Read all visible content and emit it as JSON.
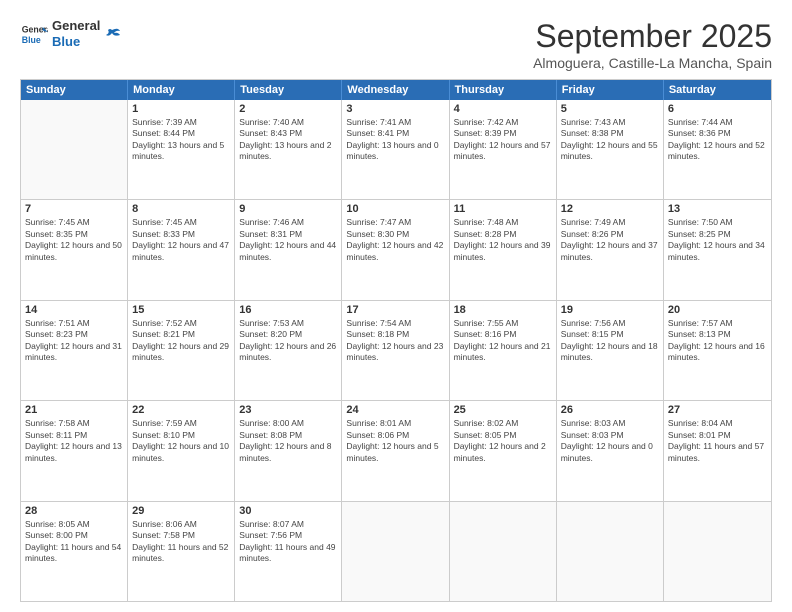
{
  "header": {
    "logo_general": "General",
    "logo_blue": "Blue",
    "month": "September 2025",
    "location": "Almoguera, Castille-La Mancha, Spain"
  },
  "days_of_week": [
    "Sunday",
    "Monday",
    "Tuesday",
    "Wednesday",
    "Thursday",
    "Friday",
    "Saturday"
  ],
  "weeks": [
    [
      {
        "day": "",
        "empty": true
      },
      {
        "day": "1",
        "sunrise": "Sunrise: 7:39 AM",
        "sunset": "Sunset: 8:44 PM",
        "daylight": "Daylight: 13 hours and 5 minutes."
      },
      {
        "day": "2",
        "sunrise": "Sunrise: 7:40 AM",
        "sunset": "Sunset: 8:43 PM",
        "daylight": "Daylight: 13 hours and 2 minutes."
      },
      {
        "day": "3",
        "sunrise": "Sunrise: 7:41 AM",
        "sunset": "Sunset: 8:41 PM",
        "daylight": "Daylight: 13 hours and 0 minutes."
      },
      {
        "day": "4",
        "sunrise": "Sunrise: 7:42 AM",
        "sunset": "Sunset: 8:39 PM",
        "daylight": "Daylight: 12 hours and 57 minutes."
      },
      {
        "day": "5",
        "sunrise": "Sunrise: 7:43 AM",
        "sunset": "Sunset: 8:38 PM",
        "daylight": "Daylight: 12 hours and 55 minutes."
      },
      {
        "day": "6",
        "sunrise": "Sunrise: 7:44 AM",
        "sunset": "Sunset: 8:36 PM",
        "daylight": "Daylight: 12 hours and 52 minutes."
      }
    ],
    [
      {
        "day": "7",
        "sunrise": "Sunrise: 7:45 AM",
        "sunset": "Sunset: 8:35 PM",
        "daylight": "Daylight: 12 hours and 50 minutes."
      },
      {
        "day": "8",
        "sunrise": "Sunrise: 7:45 AM",
        "sunset": "Sunset: 8:33 PM",
        "daylight": "Daylight: 12 hours and 47 minutes."
      },
      {
        "day": "9",
        "sunrise": "Sunrise: 7:46 AM",
        "sunset": "Sunset: 8:31 PM",
        "daylight": "Daylight: 12 hours and 44 minutes."
      },
      {
        "day": "10",
        "sunrise": "Sunrise: 7:47 AM",
        "sunset": "Sunset: 8:30 PM",
        "daylight": "Daylight: 12 hours and 42 minutes."
      },
      {
        "day": "11",
        "sunrise": "Sunrise: 7:48 AM",
        "sunset": "Sunset: 8:28 PM",
        "daylight": "Daylight: 12 hours and 39 minutes."
      },
      {
        "day": "12",
        "sunrise": "Sunrise: 7:49 AM",
        "sunset": "Sunset: 8:26 PM",
        "daylight": "Daylight: 12 hours and 37 minutes."
      },
      {
        "day": "13",
        "sunrise": "Sunrise: 7:50 AM",
        "sunset": "Sunset: 8:25 PM",
        "daylight": "Daylight: 12 hours and 34 minutes."
      }
    ],
    [
      {
        "day": "14",
        "sunrise": "Sunrise: 7:51 AM",
        "sunset": "Sunset: 8:23 PM",
        "daylight": "Daylight: 12 hours and 31 minutes."
      },
      {
        "day": "15",
        "sunrise": "Sunrise: 7:52 AM",
        "sunset": "Sunset: 8:21 PM",
        "daylight": "Daylight: 12 hours and 29 minutes."
      },
      {
        "day": "16",
        "sunrise": "Sunrise: 7:53 AM",
        "sunset": "Sunset: 8:20 PM",
        "daylight": "Daylight: 12 hours and 26 minutes."
      },
      {
        "day": "17",
        "sunrise": "Sunrise: 7:54 AM",
        "sunset": "Sunset: 8:18 PM",
        "daylight": "Daylight: 12 hours and 23 minutes."
      },
      {
        "day": "18",
        "sunrise": "Sunrise: 7:55 AM",
        "sunset": "Sunset: 8:16 PM",
        "daylight": "Daylight: 12 hours and 21 minutes."
      },
      {
        "day": "19",
        "sunrise": "Sunrise: 7:56 AM",
        "sunset": "Sunset: 8:15 PM",
        "daylight": "Daylight: 12 hours and 18 minutes."
      },
      {
        "day": "20",
        "sunrise": "Sunrise: 7:57 AM",
        "sunset": "Sunset: 8:13 PM",
        "daylight": "Daylight: 12 hours and 16 minutes."
      }
    ],
    [
      {
        "day": "21",
        "sunrise": "Sunrise: 7:58 AM",
        "sunset": "Sunset: 8:11 PM",
        "daylight": "Daylight: 12 hours and 13 minutes."
      },
      {
        "day": "22",
        "sunrise": "Sunrise: 7:59 AM",
        "sunset": "Sunset: 8:10 PM",
        "daylight": "Daylight: 12 hours and 10 minutes."
      },
      {
        "day": "23",
        "sunrise": "Sunrise: 8:00 AM",
        "sunset": "Sunset: 8:08 PM",
        "daylight": "Daylight: 12 hours and 8 minutes."
      },
      {
        "day": "24",
        "sunrise": "Sunrise: 8:01 AM",
        "sunset": "Sunset: 8:06 PM",
        "daylight": "Daylight: 12 hours and 5 minutes."
      },
      {
        "day": "25",
        "sunrise": "Sunrise: 8:02 AM",
        "sunset": "Sunset: 8:05 PM",
        "daylight": "Daylight: 12 hours and 2 minutes."
      },
      {
        "day": "26",
        "sunrise": "Sunrise: 8:03 AM",
        "sunset": "Sunset: 8:03 PM",
        "daylight": "Daylight: 12 hours and 0 minutes."
      },
      {
        "day": "27",
        "sunrise": "Sunrise: 8:04 AM",
        "sunset": "Sunset: 8:01 PM",
        "daylight": "Daylight: 11 hours and 57 minutes."
      }
    ],
    [
      {
        "day": "28",
        "sunrise": "Sunrise: 8:05 AM",
        "sunset": "Sunset: 8:00 PM",
        "daylight": "Daylight: 11 hours and 54 minutes."
      },
      {
        "day": "29",
        "sunrise": "Sunrise: 8:06 AM",
        "sunset": "Sunset: 7:58 PM",
        "daylight": "Daylight: 11 hours and 52 minutes."
      },
      {
        "day": "30",
        "sunrise": "Sunrise: 8:07 AM",
        "sunset": "Sunset: 7:56 PM",
        "daylight": "Daylight: 11 hours and 49 minutes."
      },
      {
        "day": "",
        "empty": true
      },
      {
        "day": "",
        "empty": true
      },
      {
        "day": "",
        "empty": true
      },
      {
        "day": "",
        "empty": true
      }
    ]
  ]
}
